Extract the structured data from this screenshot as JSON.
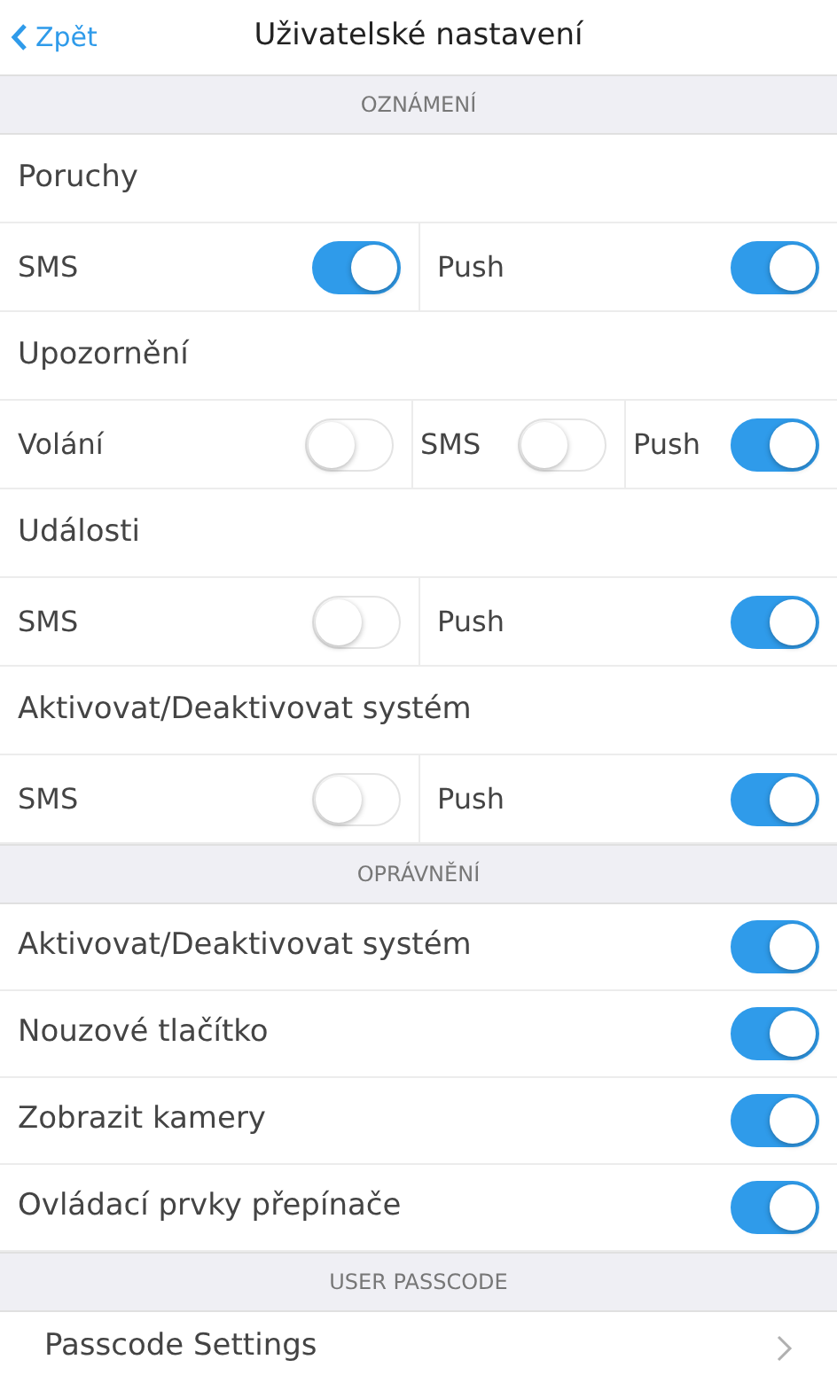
{
  "nav": {
    "back": "Zpět",
    "title": "Uživatelské nastavení"
  },
  "sections": [
    {
      "title": "OZNÁMENÍ",
      "items": [
        {
          "kind": "heading",
          "label": "Poruchy"
        },
        {
          "kind": "toggles",
          "toggles": [
            {
              "label": "SMS",
              "on": true
            },
            {
              "label": "Push",
              "on": true
            }
          ]
        },
        {
          "kind": "heading",
          "label": "Upozornění"
        },
        {
          "kind": "toggles",
          "toggles": [
            {
              "label": "Volání",
              "on": false
            },
            {
              "label": "SMS",
              "on": false
            },
            {
              "label": "Push",
              "on": true
            }
          ]
        },
        {
          "kind": "heading",
          "label": "Události"
        },
        {
          "kind": "toggles",
          "toggles": [
            {
              "label": "SMS",
              "on": false
            },
            {
              "label": "Push",
              "on": true
            }
          ]
        },
        {
          "kind": "heading",
          "label": "Aktivovat/Deaktivovat systém"
        },
        {
          "kind": "toggles",
          "toggles": [
            {
              "label": "SMS",
              "on": false
            },
            {
              "label": "Push",
              "on": true
            }
          ]
        }
      ]
    },
    {
      "title": "OPRÁVNĚNÍ",
      "items": [
        {
          "kind": "switch",
          "label": "Aktivovat/Deaktivovat systém",
          "on": true
        },
        {
          "kind": "switch",
          "label": "Nouzové tlačítko",
          "on": true
        },
        {
          "kind": "switch",
          "label": "Zobrazit kamery",
          "on": true
        },
        {
          "kind": "switch",
          "label": "Ovládací prvky přepínače",
          "on": true
        }
      ]
    },
    {
      "title": "USER PASSCODE",
      "items": [
        {
          "kind": "link",
          "label": "Passcode Settings"
        }
      ]
    }
  ]
}
